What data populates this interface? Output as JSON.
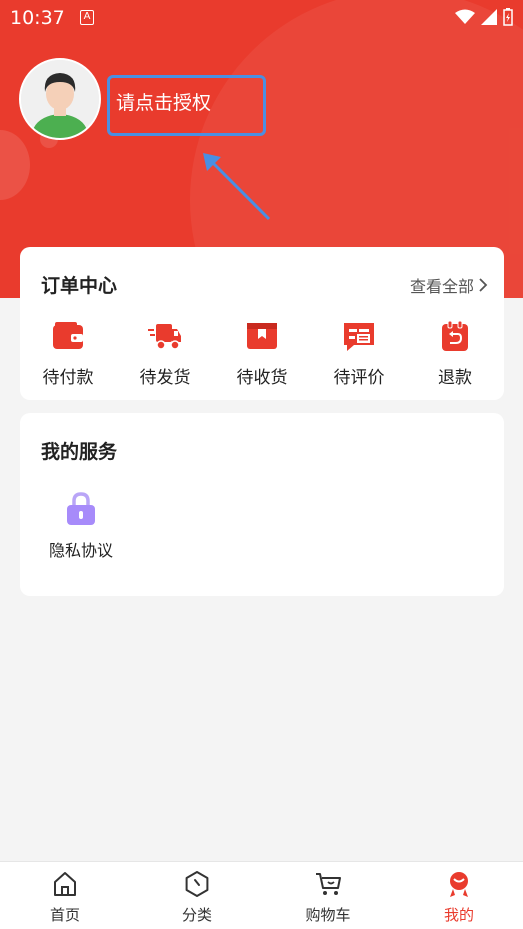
{
  "status_bar": {
    "time": "10:37",
    "app_indicator": "A"
  },
  "profile": {
    "auth_prompt": "请点击授权"
  },
  "order_center": {
    "title": "订单中心",
    "see_all": "查看全部",
    "items": [
      {
        "label": "待付款",
        "icon": "wallet-icon"
      },
      {
        "label": "待发货",
        "icon": "delivery-truck-icon"
      },
      {
        "label": "待收货",
        "icon": "package-icon"
      },
      {
        "label": "待评价",
        "icon": "review-icon"
      },
      {
        "label": "退款",
        "icon": "refund-icon"
      }
    ]
  },
  "services": {
    "title": "我的服务",
    "items": [
      {
        "label": "隐私协议",
        "icon": "lock-icon"
      }
    ]
  },
  "tabbar": {
    "items": [
      {
        "label": "首页",
        "icon": "home-icon"
      },
      {
        "label": "分类",
        "icon": "category-icon"
      },
      {
        "label": "购物车",
        "icon": "cart-icon"
      },
      {
        "label": "我的",
        "icon": "profile-icon",
        "active": true
      }
    ]
  },
  "colors": {
    "brand": "#e93b2d",
    "highlight_box": "#4a8fe2",
    "lock_icon": "#a78bfa"
  }
}
